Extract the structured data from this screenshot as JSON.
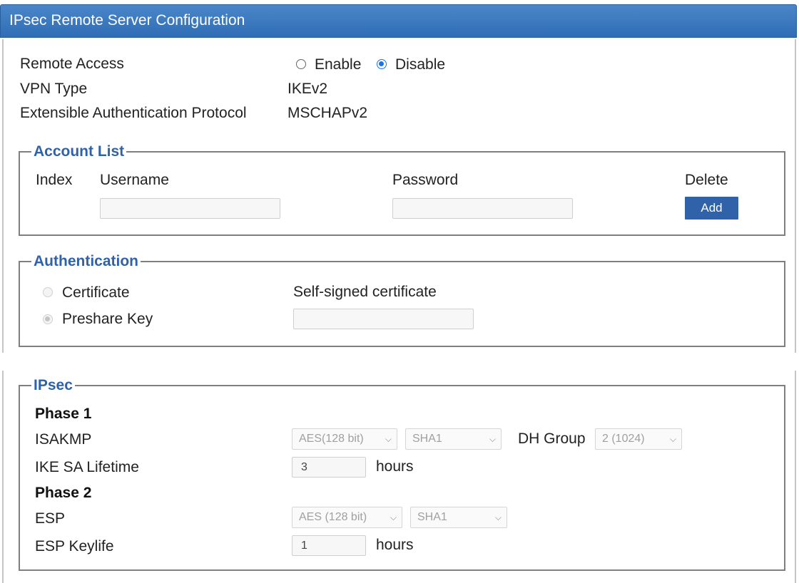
{
  "header": {
    "title": "IPsec Remote Server Configuration"
  },
  "general": {
    "remote_access_label": "Remote Access",
    "enable_label": "Enable",
    "disable_label": "Disable",
    "remote_access_selected": "Disable",
    "vpn_type_label": "VPN Type",
    "vpn_type_value": "IKEv2",
    "eap_label": "Extensible Authentication Protocol",
    "eap_value": "MSCHAPv2"
  },
  "account_list": {
    "legend": "Account List",
    "columns": [
      "Index",
      "Username",
      "Password",
      "Delete"
    ],
    "username_value": "",
    "password_value": "",
    "add_label": "Add"
  },
  "authentication": {
    "legend": "Authentication",
    "certificate_label": "Certificate",
    "preshare_label": "Preshare Key",
    "selected": "Preshare Key",
    "self_signed_label": "Self-signed certificate",
    "preshare_value": ""
  },
  "ipsec": {
    "legend": "IPsec",
    "phase1_heading": "Phase 1",
    "isakmp_label": "ISAKMP",
    "isakmp_encryption": "AES(128 bit)",
    "isakmp_hash": "SHA1",
    "dh_group_label": "DH Group",
    "dh_group_value": "2 (1024)",
    "ike_lifetime_label": "IKE SA Lifetime",
    "ike_lifetime_value": "3",
    "hours_label": "hours",
    "phase2_heading": "Phase 2",
    "esp_label": "ESP",
    "esp_encryption": "AES (128 bit)",
    "esp_hash": "SHA1",
    "esp_keylife_label": "ESP Keylife",
    "esp_keylife_value": "1"
  },
  "colors": {
    "header": "#2f6db5",
    "accent": "#2f62a8",
    "radio_checked": "#1a73e8"
  },
  "icons": {
    "select_arrow": "chevron-down-icon"
  }
}
